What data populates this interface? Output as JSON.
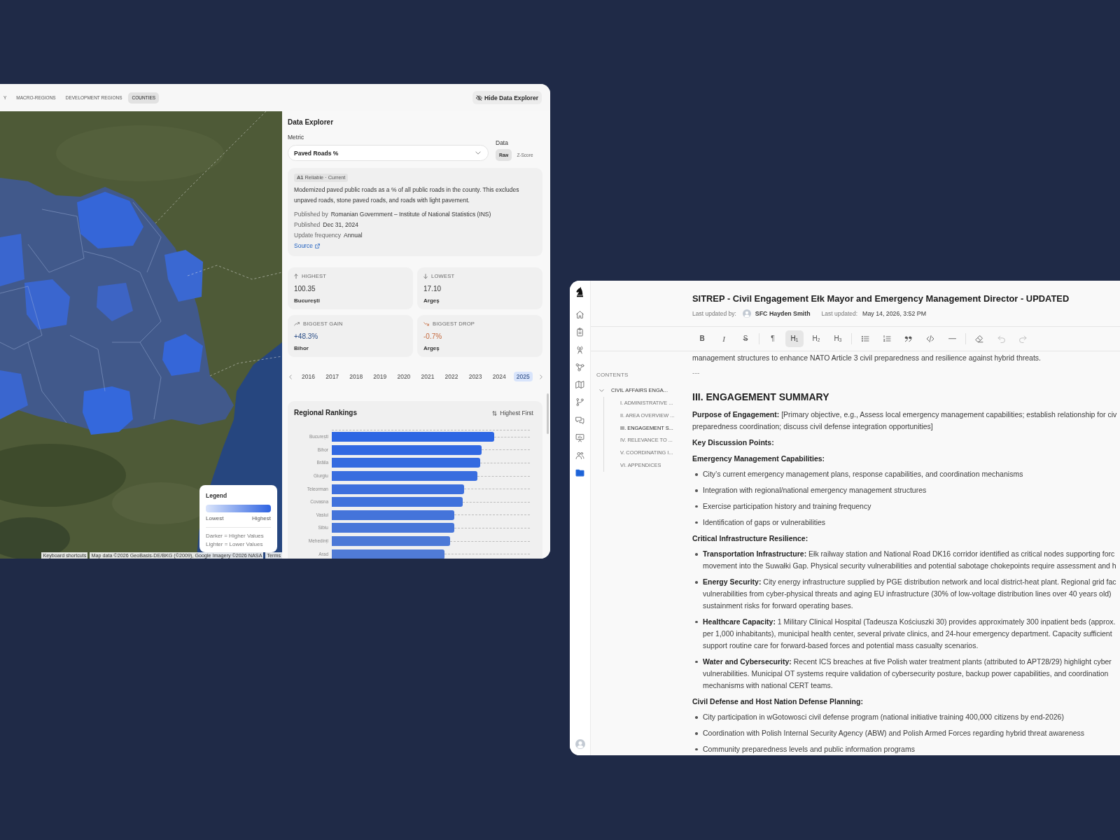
{
  "map_window": {
    "tabs": [
      {
        "label": "Y",
        "selected": false
      },
      {
        "label": "MACRO-REGIONS",
        "selected": false
      },
      {
        "label": "DEVELOPMENT REGIONS",
        "selected": false
      },
      {
        "label": "COUNTIES",
        "selected": true
      }
    ],
    "hide_button": "Hide Data Explorer",
    "legend": {
      "title": "Legend",
      "low": "Lowest",
      "high": "Highest",
      "notes": [
        "Darker = Higher Values",
        "Lighter = Lower Values"
      ]
    },
    "attribution": [
      "Keyboard shortcuts",
      "Map data ©2026 GeoBasis-DE/BKG (©2009), Google Imagery ©2026 NASA",
      "Terms"
    ],
    "data_explorer": {
      "title": "Data Explorer",
      "metric": {
        "label": "Metric",
        "value": "Paved Roads %"
      },
      "data_mode": {
        "label": "Data",
        "options": [
          {
            "label": "Raw",
            "selected": true
          },
          {
            "label": "Z-Score",
            "selected": false
          }
        ]
      },
      "info": {
        "badge": "**A1** Reliable · Current",
        "description": "Modernized paved public roads as a % of all public roads in the county. This excludes unpaved roads, stone paved roads, and roads with light pavement.",
        "meta": [
          {
            "label": "Published by",
            "value": "Romanian Government – Institute of National Statistics (INS)"
          },
          {
            "label": "Published",
            "value": "Dec 31, 2024"
          },
          {
            "label": "Update frequency",
            "value": "Annual"
          }
        ],
        "source": "Source"
      },
      "stats": [
        {
          "kind": "highest",
          "label": "HIGHEST",
          "value": "100.35",
          "region": "București"
        },
        {
          "kind": "lowest",
          "label": "LOWEST",
          "value": "17.10",
          "region": "Argeș"
        },
        {
          "kind": "gain",
          "label": "BIGGEST GAIN",
          "value": "+48.3%",
          "region": "Bihor"
        },
        {
          "kind": "drop",
          "label": "BIGGEST DROP",
          "value": "-0.7%",
          "region": "Argeș"
        }
      ],
      "years": [
        {
          "label": "2016",
          "selected": false
        },
        {
          "label": "2017",
          "selected": false
        },
        {
          "label": "2018",
          "selected": false
        },
        {
          "label": "2019",
          "selected": false
        },
        {
          "label": "2020",
          "selected": false
        },
        {
          "label": "2021",
          "selected": false
        },
        {
          "label": "2022",
          "selected": false
        },
        {
          "label": "2023",
          "selected": false
        },
        {
          "label": "2024",
          "selected": false
        },
        {
          "label": "2025",
          "selected": true
        }
      ],
      "rankings": {
        "title": "Regional Rankings",
        "sort": "Highest First",
        "regions": [
          "București",
          "Bihor",
          "Brăila",
          "Giurgiu",
          "Teleorman",
          "Covasna",
          "Vaslui",
          "Sibiu",
          "Mehedinți",
          "Arad"
        ]
      }
    }
  },
  "editor_window": {
    "nav": [
      {
        "selected": false
      },
      {
        "selected": false
      },
      {
        "selected": false
      },
      {
        "selected": false
      },
      {
        "selected": false
      },
      {
        "selected": false
      },
      {
        "selected": false
      },
      {
        "selected": false
      },
      {
        "selected": false
      },
      {
        "selected": true
      }
    ],
    "title": "SITREP - Civil Engagement Ełk Mayor and Emergency Management Director - UPDATED",
    "meta": {
      "updated_by_label": "Last updated by:",
      "author": "SFC Hayden Smith",
      "updated_label": "Last updated:",
      "updated_at": "May 14, 2026, 3:52 PM"
    },
    "toolbar": [
      {
        "items": [
          {
            "kind": "glyph",
            "label": "B",
            "active": false,
            "disabled": false
          },
          {
            "kind": "glyph",
            "label": "I",
            "active": false,
            "disabled": false
          },
          {
            "kind": "glyph",
            "label": "S",
            "active": false,
            "disabled": false
          }
        ]
      },
      {
        "items": [
          {
            "kind": "glyph",
            "label": "¶",
            "active": false,
            "disabled": false
          },
          {
            "kind": "glyph",
            "label": "H$_{1}$",
            "active": true,
            "disabled": false
          },
          {
            "kind": "glyph",
            "label": "H$_{2}$",
            "active": false,
            "disabled": false
          },
          {
            "kind": "glyph",
            "label": "H$_{3}$",
            "active": false,
            "disabled": false
          }
        ]
      },
      {
        "items": [
          {
            "kind": "icon",
            "active": false,
            "disabled": false
          },
          {
            "kind": "icon",
            "active": false,
            "disabled": false
          },
          {
            "kind": "icon",
            "active": false,
            "disabled": false
          },
          {
            "kind": "icon",
            "active": false,
            "disabled": false
          },
          {
            "kind": "icon",
            "active": false,
            "disabled": false
          }
        ]
      },
      {
        "items": [
          {
            "kind": "icon",
            "active": false,
            "disabled": false
          },
          {
            "kind": "icon",
            "active": false,
            "disabled": true
          },
          {
            "kind": "icon",
            "active": false,
            "disabled": true
          }
        ]
      }
    ],
    "contents": {
      "heading": "CONTENTS",
      "items": [
        {
          "label": "CIVIL AFFAIRS ENGA...",
          "expanded": true,
          "selected": false,
          "children": [
            {
              "label": "I. ADMINISTRATIVE ...",
              "selected": false
            },
            {
              "label": "II. AREA OVERVIEW ...",
              "selected": false
            },
            {
              "label": "III. ENGAGEMENT S...",
              "selected": true
            },
            {
              "label": "IV. RELEVANCE TO ...",
              "selected": false
            },
            {
              "label": "V. COORDINATING I...",
              "selected": false
            },
            {
              "label": "VI. APPENDICES",
              "selected": false
            }
          ]
        }
      ]
    },
    "document": [
      {
        "kind": "paragraph",
        "lines": [
          "management structures to enhance NATO Article 3 civil preparedness and resilience against hybrid threats."
        ]
      },
      {
        "kind": "rule",
        "lines": [
          "---"
        ]
      },
      {
        "kind": "heading",
        "lines": [
          "III. ENGAGEMENT SUMMARY"
        ]
      },
      {
        "kind": "paragraph",
        "lines": [
          "**Purpose of Engagement:** [Primary objective, e.g., Assess local emergency management capabilities; establish relationship for civ",
          "preparedness coordination; discuss civil defense integration opportunities]"
        ]
      },
      {
        "kind": "subheading",
        "lines": [
          "Key Discussion Points:"
        ]
      },
      {
        "kind": "subheading",
        "lines": [
          "Emergency Management Capabilities:"
        ]
      },
      {
        "kind": "bullet",
        "lines": [
          "City’s current emergency management plans, response capabilities, and coordination mechanisms"
        ]
      },
      {
        "kind": "bullet",
        "lines": [
          "Integration with regional/national emergency management structures"
        ]
      },
      {
        "kind": "bullet",
        "lines": [
          "Exercise participation history and training frequency"
        ]
      },
      {
        "kind": "bullet",
        "lines": [
          "Identification of gaps or vulnerabilities"
        ]
      },
      {
        "kind": "subheading",
        "lines": [
          "Critical Infrastructure Resilience:"
        ]
      },
      {
        "kind": "bullet",
        "lines": [
          "**Transportation Infrastructure:** Ełk railway station and National Road DK16 corridor identified as critical nodes supporting forc",
          "movement into the Suwałki Gap. Physical security vulnerabilities and potential sabotage chokepoints require assessment and h"
        ]
      },
      {
        "kind": "bullet",
        "lines": [
          "**Energy Security:** City energy infrastructure supplied by PGE distribution network and local district-heat plant. Regional grid fac",
          "vulnerabilities from cyber-physical threats and aging EU infrastructure (30% of low-voltage distribution lines over 40 years old)",
          "sustainment risks for forward operating bases."
        ]
      },
      {
        "kind": "bullet",
        "lines": [
          "**Healthcare Capacity:** 1 Military Clinical Hospital (Tadeusza Kościuszki 30) provides approximately 300 inpatient beds (approx.",
          "per 1,000 inhabitants), municipal health center, several private clinics, and 24-hour emergency department. Capacity sufficient",
          "support routine care for forward-based forces and potential mass casualty scenarios."
        ]
      },
      {
        "kind": "bullet",
        "lines": [
          "**Water and Cybersecurity:** Recent ICS breaches at five Polish water treatment plants (attributed to APT28/29) highlight cyber",
          "vulnerabilities. Municipal OT systems require validation of cybersecurity posture, backup power capabilities, and coordination",
          "mechanisms with national CERT teams."
        ]
      },
      {
        "kind": "subheading",
        "lines": [
          "Civil Defense and Host Nation Defense Planning:"
        ]
      },
      {
        "kind": "bullet",
        "lines": [
          "City participation in wGotowosci civil defense program (national initiative training 400,000 citizens by end-2026)"
        ]
      },
      {
        "kind": "bullet",
        "lines": [
          "Coordination with Polish Internal Security Agency (ABW) and Polish Armed Forces regarding hybrid threat awareness"
        ]
      },
      {
        "kind": "bullet",
        "lines": [
          "Community preparedness levels and public information programs"
        ]
      }
    ]
  }
}
